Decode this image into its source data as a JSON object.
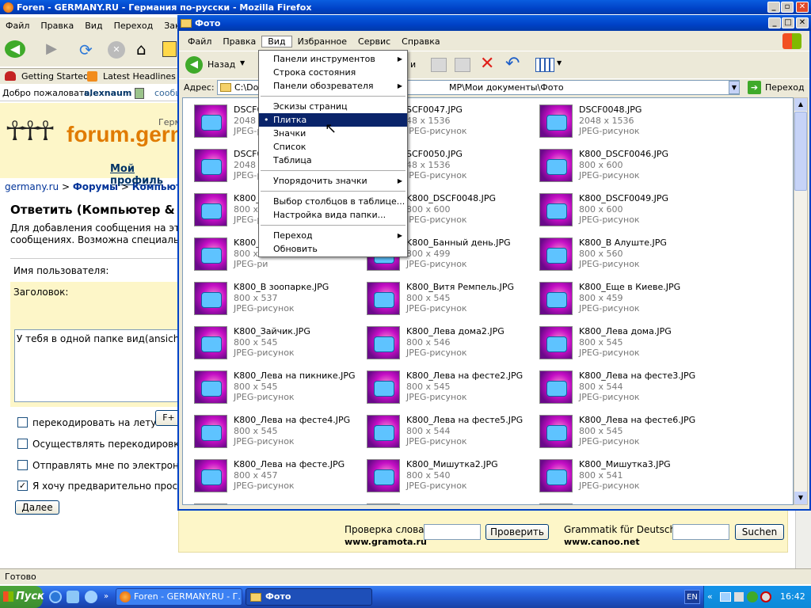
{
  "firefox": {
    "title": "Foren - GERMANY.RU - Германия по-русски - Mozilla Firefox",
    "menu": [
      "Файл",
      "Правка",
      "Вид",
      "Переход",
      "Закл"
    ],
    "bookmarks": [
      "Getting Started",
      "Latest Headlines"
    ],
    "welcome": "Добро пожаловать,",
    "username": "alexnaum",
    "welcome_link": "сообщ",
    "logo_text": "forum.germ",
    "logo_top": "Герм",
    "profile_link": "Мой профиль",
    "breadcrumb": {
      "root": "germany.ru",
      "sep1": " > ",
      "forums": "Форумы",
      "sep2": " > ",
      "section": "Компьюте"
    },
    "heading": "Ответить (Компьютер & Со",
    "desc1": "Для добавления сообщения на этот",
    "desc2": "сообщениях. Возможна специальна",
    "label_user": "Имя пользователя:",
    "label_subject": "Заголовок:",
    "message_text": "У тебя в одной папке вид(ansicht) у",
    "checks": [
      {
        "label": "перекодировать на лету:",
        "checked": false
      },
      {
        "label": "Осуществлять перекодировку",
        "checked": false
      },
      {
        "label": "Отправлять мне по электронн",
        "checked": false
      },
      {
        "label": "Я хочу предварительно просм",
        "checked": true
      }
    ],
    "f_button": "F+",
    "next_button": "Далее",
    "spell_label": "Проверка слова",
    "spell_button": "Проверить",
    "spell_site": "www.gramota.ru",
    "gram_label": "Grammatik für Deutsch",
    "gram_button": "Suchen",
    "gram_site": "www.canoo.net",
    "status": "Готово"
  },
  "explorer": {
    "title": "Фото",
    "menu": [
      "Файл",
      "Правка",
      "Вид",
      "Избранное",
      "Сервис",
      "Справка"
    ],
    "back_label": "Назад",
    "forward_label": "и",
    "address_label": "Адрес:",
    "address_prefix": "C:\\Do",
    "address_value": "MP\\Мои документы\\Фото",
    "go_label": "Переход",
    "files": [
      {
        "name": "DSCF00",
        "size": "2048 x 6",
        "type": "JPEG-ри"
      },
      {
        "name": "SCF0047.JPG",
        "size": "48 x 1536",
        "type": "JPEG-рисунок"
      },
      {
        "name": "DSCF0048.JPG",
        "size": "2048 x 1536",
        "type": "JPEG-рисунок"
      },
      {
        "name": "DSCF00",
        "size": "2048 x 6",
        "type": "JPEG-ри"
      },
      {
        "name": "SCF0050.JPG",
        "size": "48 x 1536",
        "type": "JPEG-рисунок"
      },
      {
        "name": "K800_DSCF0046.JPG",
        "size": "800 x 600",
        "type": "JPEG-рисунок"
      },
      {
        "name": "K800_D",
        "size": "800 x 6",
        "type": "JPEG-ри"
      },
      {
        "name": "K800_DSCF0048.JPG",
        "size": "800 x 600",
        "type": "JPEG-рисунок"
      },
      {
        "name": "K800_DSCF0049.JPG",
        "size": "800 x 600",
        "type": "JPEG-рисунок"
      },
      {
        "name": "K800_D",
        "size": "800 x 6",
        "type": "JPEG-ри"
      },
      {
        "name": "K800_Банный день.JPG",
        "size": "800 x 499",
        "type": "JPEG-рисунок"
      },
      {
        "name": "K800_В Алуште.JPG",
        "size": "800 x 560",
        "type": "JPEG-рисунок"
      },
      {
        "name": "K800_В зоопарке.JPG",
        "size": "800 x 537",
        "type": "JPEG-рисунок"
      },
      {
        "name": "K800_Витя Ремпель.JPG",
        "size": "800 x 545",
        "type": "JPEG-рисунок"
      },
      {
        "name": "K800_Еще в Киеве.JPG",
        "size": "800 x 459",
        "type": "JPEG-рисунок"
      },
      {
        "name": "K800_Зайчик.JPG",
        "size": "800 x 545",
        "type": "JPEG-рисунок"
      },
      {
        "name": "K800_Лева дома2.JPG",
        "size": "800 x 546",
        "type": "JPEG-рисунок"
      },
      {
        "name": "K800_Лева дома.JPG",
        "size": "800 x 545",
        "type": "JPEG-рисунок"
      },
      {
        "name": "K800_Лева на пикнике.JPG",
        "size": "800 x 545",
        "type": "JPEG-рисунок"
      },
      {
        "name": "K800_Лева на фесте2.JPG",
        "size": "800 x 545",
        "type": "JPEG-рисунок"
      },
      {
        "name": "K800_Лева на фесте3.JPG",
        "size": "800 x 544",
        "type": "JPEG-рисунок"
      },
      {
        "name": "K800_Лева на фесте4.JPG",
        "size": "800 x 545",
        "type": "JPEG-рисунок"
      },
      {
        "name": "K800_Лева на фесте5.JPG",
        "size": "800 x 544",
        "type": "JPEG-рисунок"
      },
      {
        "name": "K800_Лева на фесте6.JPG",
        "size": "800 x 545",
        "type": "JPEG-рисунок"
      },
      {
        "name": "K800_Лева на фесте.JPG",
        "size": "800 x 457",
        "type": "JPEG-рисунок"
      },
      {
        "name": "K800_Мишутка2.JPG",
        "size": "800 x 540",
        "type": "JPEG-рисунок"
      },
      {
        "name": "K800_Мишутка3.JPG",
        "size": "800 x 541",
        "type": "JPEG-рисунок"
      }
    ]
  },
  "view_menu": {
    "items": [
      {
        "label": "Панели инструментов",
        "submenu": true
      },
      {
        "label": "Строка состояния"
      },
      {
        "label": "Панели обозревателя",
        "submenu": true
      },
      {
        "sep": true
      },
      {
        "label": "Эскизы страниц"
      },
      {
        "label": "Плитка",
        "bullet": true,
        "selected": true
      },
      {
        "label": "Значки"
      },
      {
        "label": "Список"
      },
      {
        "label": "Таблица"
      },
      {
        "sep": true
      },
      {
        "label": "Упорядочить значки",
        "submenu": true
      },
      {
        "sep": true
      },
      {
        "label": "Выбор столбцов в таблице..."
      },
      {
        "label": "Настройка вида папки..."
      },
      {
        "sep": true
      },
      {
        "label": "Переход",
        "submenu": true
      },
      {
        "label": "Обновить"
      }
    ]
  },
  "taskbar": {
    "start": "Пуск",
    "tasks": [
      "Foren - GERMANY.RU - Г...",
      "Фото"
    ],
    "lang": "EN",
    "clock": "16:42"
  },
  "colors": {
    "titlebar": "#0042c7",
    "taskbar": "#245edb",
    "menu_highlight": "#0a246a",
    "start": "#3c8d2f"
  }
}
